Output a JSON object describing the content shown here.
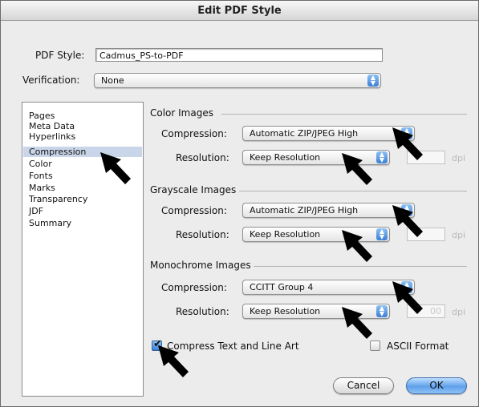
{
  "window": {
    "title": "Edit PDF Style"
  },
  "pdf_style": {
    "label": "PDF Style:",
    "value": "Cadmus_PS-to-PDF"
  },
  "verification": {
    "label": "Verification:",
    "value": "None"
  },
  "categories": {
    "items": [
      "Pages",
      "Meta Data",
      "Hyperlinks",
      "Compression",
      "Color",
      "Fonts",
      "Marks",
      "Transparency",
      "JDF",
      "Summary"
    ],
    "selected": "Compression"
  },
  "color_images": {
    "title": "Color Images",
    "compression_label": "Compression:",
    "compression_value": "Automatic ZIP/JPEG High",
    "resolution_label": "Resolution:",
    "resolution_value": "Keep Resolution",
    "dpi_unit": "dpi"
  },
  "grayscale_images": {
    "title": "Grayscale Images",
    "compression_label": "Compression:",
    "compression_value": "Automatic ZIP/JPEG High",
    "resolution_label": "Resolution:",
    "resolution_value": "Keep Resolution",
    "dpi_unit": "dpi"
  },
  "monochrome_images": {
    "title": "Monochrome Images",
    "compression_label": "Compression:",
    "compression_value": "CCITT Group 4",
    "resolution_label": "Resolution:",
    "resolution_value": "Keep Resolution",
    "dpi_value": "00",
    "dpi_unit": "dpi"
  },
  "options": {
    "compress_text_label": "Compress Text and Line Art",
    "compress_text_checked": true,
    "ascii_format_label": "ASCII Format",
    "ascii_format_checked": false
  },
  "buttons": {
    "cancel": "Cancel",
    "ok": "OK"
  },
  "colors": {
    "selection": "#c9d5e8",
    "accent": "#3a7fd5",
    "dialog_bg": "#ececec"
  }
}
